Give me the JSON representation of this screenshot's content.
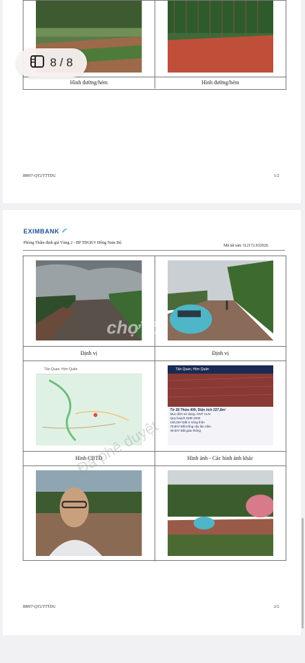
{
  "viewer": {
    "counter": "8 / 8"
  },
  "page1": {
    "captions": [
      "Hình đường/hẻm",
      "Hình đường/hẻm"
    ],
    "footer_left": "BM07-QT2/TTTDG",
    "footer_right": "1/2"
  },
  "page2": {
    "brand": "EXIMBANK",
    "department": "Phòng Thẩm định giá Vùng 2 - BP TĐGKV Đông Nam Bộ",
    "asset_code": "Mã tài sản: I12172.032026",
    "captions": [
      "Định vị",
      "Định vị",
      "Hình CBTĐ",
      "Hình ảnh - Các hình ảnh khác"
    ],
    "map_search": "Tân Quan, Hớn Quản",
    "listing_title": "Tờ 28 Thửa 409, Diện tích 227,8m²",
    "listing_lines": [
      "Mục đích sử dụng: ONT CLN",
      "Quy hoạch SDĐ 2030",
      "100,0m² Đất ở nông thôn",
      "78,8m² Đất trồng cây lâu năm",
      "49,0m² Đất giao thông"
    ],
    "watermark_1": "chợTốt",
    "watermark_2": "Đã phê duyệt",
    "footer_left": "BM07-QT2/TTTDG",
    "footer_right": "2/2"
  },
  "colors": {
    "brand": "#1e4f9a",
    "accent": "#4fb3e8"
  }
}
